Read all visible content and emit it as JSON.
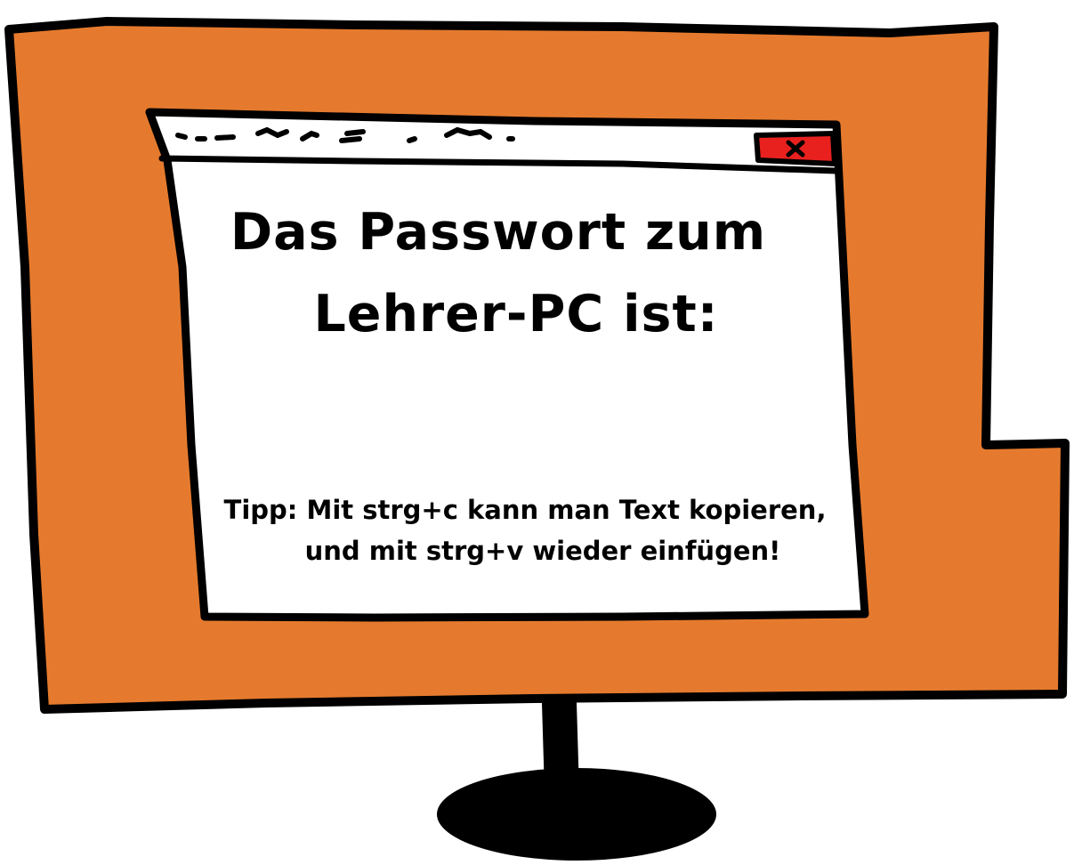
{
  "dialog": {
    "headline_line1": "Das Passwort zum",
    "headline_line2": "Lehrer-PC ist:",
    "tip_line1": "Tipp: Mit strg+c kann man Text kopieren,",
    "tip_line2": "und mit strg+v wieder einfügen!",
    "close_icon": "close-icon"
  },
  "colors": {
    "monitor_frame": "#E57A2E",
    "outline": "#000000",
    "window_background": "#FFFFFF",
    "close_button": "#E8211F"
  }
}
